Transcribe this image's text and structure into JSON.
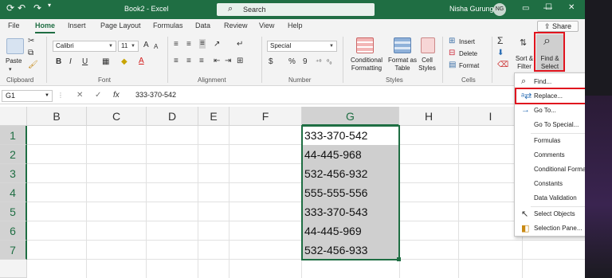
{
  "titlebar": {
    "title": "Book2 - Excel",
    "search_placeholder": "Search",
    "user_name": "Nisha Gurung",
    "user_initials": "NG",
    "minimize": "—",
    "maximize": "☐",
    "close": "✕",
    "autosave_icon": "save-icon",
    "undo_icon": "↶",
    "redo_icon": "↷"
  },
  "tabs": [
    "File",
    "Home",
    "Insert",
    "Page Layout",
    "Formulas",
    "Data",
    "Review",
    "View",
    "Help"
  ],
  "active_tab": "Home",
  "share_label": "Share",
  "ribbon": {
    "clipboard": {
      "label": "Clipboard",
      "paste": "Paste"
    },
    "font": {
      "label": "Font",
      "font_name": "Calibri",
      "font_size": "11",
      "bold": "B",
      "italic": "I",
      "underline": "U",
      "grow": "A",
      "shrink": "A"
    },
    "alignment": {
      "label": "Alignment"
    },
    "number": {
      "label": "Number",
      "format": "Special",
      "currency": "$",
      "percent": "%",
      "comma": "9"
    },
    "styles": {
      "label": "Styles",
      "conditional": "Conditional Formatting",
      "format_as_table": "Format as Table",
      "cell_styles": "Cell Styles"
    },
    "cells": {
      "label": "Cells",
      "insert": "Insert",
      "delete": "Delete",
      "format": "Format"
    },
    "editing": {
      "sum": "Σ",
      "sort_filter": "Sort & Filter",
      "find_select": "Find & Select"
    }
  },
  "formula_bar": {
    "name_box": "G1",
    "cancel": "✕",
    "enter": "✓",
    "fx": "fx",
    "value": "333-370-542"
  },
  "columns": [
    "B",
    "C",
    "D",
    "E",
    "F",
    "G",
    "H",
    "I"
  ],
  "selected_column": "G",
  "rows": [
    "1",
    "2",
    "3",
    "4",
    "5",
    "6",
    "7"
  ],
  "cells_G": [
    "333-370-542",
    "44-445-968",
    "532-456-932",
    "555-555-556",
    "333-370-543",
    "44-445-969",
    "532-456-933"
  ],
  "find_menu": {
    "items": [
      {
        "label": "Find...",
        "icon": "search-icon"
      },
      {
        "label": "Replace...",
        "icon": "replace-icon"
      },
      {
        "label": "Go To...",
        "icon": "arrow-right-icon"
      },
      {
        "label": "Go To Special..."
      },
      {
        "label": "Formulas"
      },
      {
        "label": "Comments"
      },
      {
        "label": "Conditional Formatting"
      },
      {
        "label": "Constants"
      },
      {
        "label": "Data Validation"
      },
      {
        "label": "Select Objects",
        "icon": "cursor-icon"
      },
      {
        "label": "Selection Pane...",
        "icon": "selection-pane-icon"
      }
    ]
  },
  "colors": {
    "excel_green": "#1f6e43",
    "highlight_red": "#e0141e",
    "selected_fill": "#cfcfcf"
  }
}
